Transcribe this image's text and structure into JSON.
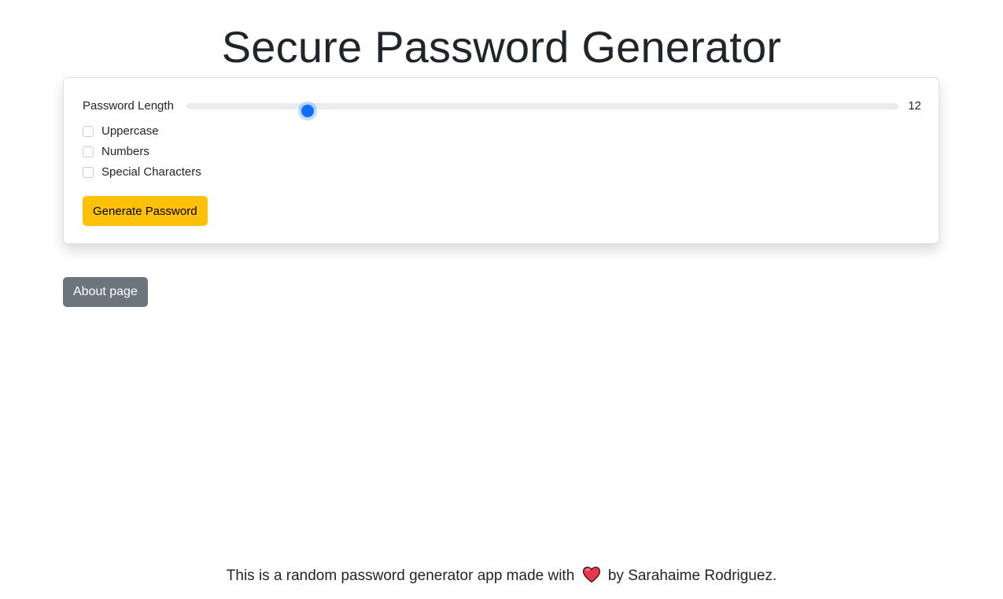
{
  "header": {
    "title": "Secure Password Generator"
  },
  "options": {
    "length_label": "Password Length",
    "length_value": "12",
    "length_fraction": 0.17,
    "checkboxes": [
      {
        "label": "Uppercase",
        "checked": false
      },
      {
        "label": "Numbers",
        "checked": false
      },
      {
        "label": "Special Characters",
        "checked": false
      }
    ],
    "generate_label": "Generate Password"
  },
  "nav": {
    "about_label": "About page"
  },
  "footer": {
    "text_before": "This is a random password generator app made with",
    "icon": "heart-icon",
    "text_after": "by Sarahaime Rodriguez."
  },
  "colors": {
    "accent": "#0d6efd",
    "generate_button": "#ffc107",
    "about_button": "#6c757d",
    "heart": "#e8374b"
  }
}
